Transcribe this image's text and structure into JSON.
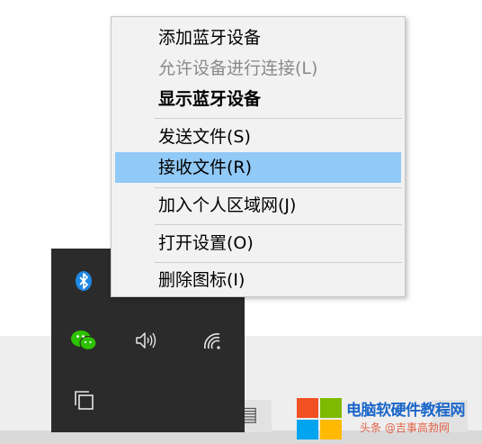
{
  "context_menu": {
    "items": [
      {
        "label": "添加蓝牙设备",
        "state": "normal"
      },
      {
        "label": "允许设备进行连接(L)",
        "state": "disabled"
      },
      {
        "label": "显示蓝牙设备",
        "state": "bold"
      },
      {
        "label": "发送文件(S)",
        "state": "normal"
      },
      {
        "label": "接收文件(R)",
        "state": "hover"
      },
      {
        "label": "加入个人区域网(J)",
        "state": "normal"
      },
      {
        "label": "打开设置(O)",
        "state": "normal"
      },
      {
        "label": "删除图标(I)",
        "state": "normal"
      }
    ]
  },
  "tray_flyout": {
    "icons": [
      "bluetooth-icon",
      "wechat-icon",
      "volume-icon",
      "wifi-icon",
      "copy-icon"
    ]
  },
  "watermark": {
    "title": "电脑软硬件教程网",
    "subtitle": "头条 @吉事高勃网"
  },
  "colors": {
    "menu_bg": "#f2f2f2",
    "hover": "#91c9f7",
    "tray_bg": "#2b2b2b",
    "bluetooth": "#1e88e5",
    "wechat": "#2dc100",
    "win_red": "#f25022",
    "win_green": "#7fba00",
    "win_blue": "#00a4ef",
    "win_yellow": "#ffb900"
  }
}
